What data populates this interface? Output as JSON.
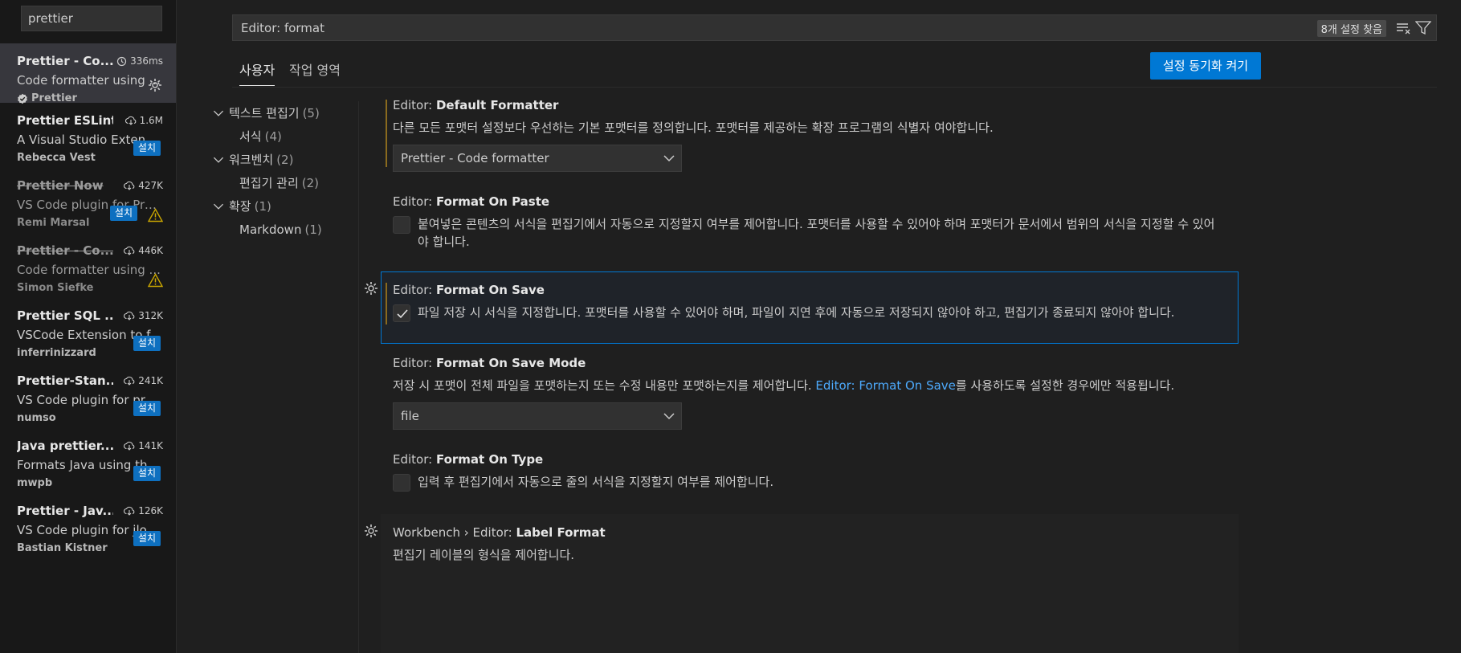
{
  "sidebar": {
    "search_value": "prettier",
    "extensions": [
      {
        "name": "Prettier - Co...",
        "meta": "336ms",
        "meta_icon": "history-icon",
        "desc": "Code formatter using ...",
        "publisher": "Prettier",
        "verified": true,
        "action": "gear",
        "deprecated": false
      },
      {
        "name": "Prettier ESLint",
        "meta": "1.6M",
        "meta_icon": "download-icon",
        "desc": "A Visual Studio Extensi...",
        "publisher": "Rebecca Vest",
        "action": "install",
        "install_label": "설치",
        "deprecated": false
      },
      {
        "name": "Prettier Now",
        "meta": "427K",
        "meta_icon": "download-icon",
        "desc": "VS Code plugin for Pre...",
        "publisher": "Remi Marsal",
        "action": "install-warn",
        "install_label": "설치",
        "deprecated": true
      },
      {
        "name": "Prettier - Co...",
        "meta": "446K",
        "meta_icon": "download-icon",
        "desc": "Code formatter using ...",
        "publisher": "Simon Siefke",
        "action": "warn",
        "deprecated": true
      },
      {
        "name": "Prettier SQL ...",
        "meta": "312K",
        "meta_icon": "download-icon",
        "desc": "VSCode Extension to f...",
        "publisher": "inferrinizzard",
        "action": "install",
        "install_label": "설치",
        "deprecated": false
      },
      {
        "name": "Prettier-Stan...",
        "meta": "241K",
        "meta_icon": "download-icon",
        "desc": "VS Code plugin for pre...",
        "publisher": "numso",
        "action": "install",
        "install_label": "설치",
        "deprecated": false
      },
      {
        "name": "Java prettier...",
        "meta": "141K",
        "meta_icon": "download-icon",
        "desc": "Formats Java using the...",
        "publisher": "mwpb",
        "action": "install",
        "install_label": "설치",
        "deprecated": false
      },
      {
        "name": "Prettier - Jav...",
        "meta": "126K",
        "meta_icon": "download-icon",
        "desc": "VS Code plugin for jlo...",
        "publisher": "Bastian Kistner",
        "action": "install",
        "install_label": "설치",
        "deprecated": false
      }
    ]
  },
  "settings": {
    "search_value": "Editor: format",
    "found_badge": "8개 설정 찾음",
    "tabs": [
      "사용자",
      "작업 영역"
    ],
    "sync_button": "설정 동기화 켜기",
    "toc": [
      {
        "label": "텍스트 편집기",
        "count": "(5)",
        "level": 0
      },
      {
        "label": "서식",
        "count": "(4)",
        "level": 1
      },
      {
        "label": "워크벤치",
        "count": "(2)",
        "level": 0
      },
      {
        "label": "편집기 관리",
        "count": "(2)",
        "level": 1
      },
      {
        "label": "확장",
        "count": "(1)",
        "level": 0
      },
      {
        "label": "Markdown",
        "count": "(1)",
        "level": 1
      }
    ],
    "items": {
      "default_formatter": {
        "prefix": "Editor: ",
        "name": "Default Formatter",
        "desc": "다른 모든 포맷터 설정보다 우선하는 기본 포맷터를 정의합니다. 포맷터를 제공하는 확장 프로그램의 식별자 여야합니다.",
        "value": "Prettier - Code formatter"
      },
      "format_on_paste": {
        "prefix": "Editor: ",
        "name": "Format On Paste",
        "desc": "붙여넣은 콘텐츠의 서식을 편집기에서 자동으로 지정할지 여부를 제어합니다. 포맷터를 사용할 수 있어야 하며 포맷터가 문서에서 범위의 서식을 지정할 수 있어야 합니다.",
        "checked": false
      },
      "format_on_save": {
        "prefix": "Editor: ",
        "name": "Format On Save",
        "desc": "파일 저장 시 서식을 지정합니다. 포맷터를 사용할 수 있어야 하며, 파일이 지연 후에 자동으로 저장되지 않아야 하고, 편집기가 종료되지 않아야 합니다.",
        "checked": true
      },
      "format_on_save_mode": {
        "prefix": "Editor: ",
        "name": "Format On Save Mode",
        "desc_before": "저장 시 포맷이 전체 파일을 포맷하는지 또는 수정 내용만 포맷하는지를 제어합니다. ",
        "desc_link": "Editor: Format On Save",
        "desc_after": "를 사용하도록 설정한 경우에만 적용됩니다.",
        "value": "file"
      },
      "format_on_type": {
        "prefix": "Editor: ",
        "name": "Format On Type",
        "desc": "입력 후 편집기에서 자동으로 줄의 서식을 지정할지 여부를 제어합니다.",
        "checked": false
      },
      "label_format": {
        "prefix": "Workbench › Editor: ",
        "name": "Label Format",
        "desc": "편집기 레이블의 형식을 제어합니다."
      }
    }
  },
  "colors": {
    "accent": "#0078d4",
    "link": "#4daafc",
    "modified": "#8a6a1e",
    "warning": "#cca700"
  }
}
